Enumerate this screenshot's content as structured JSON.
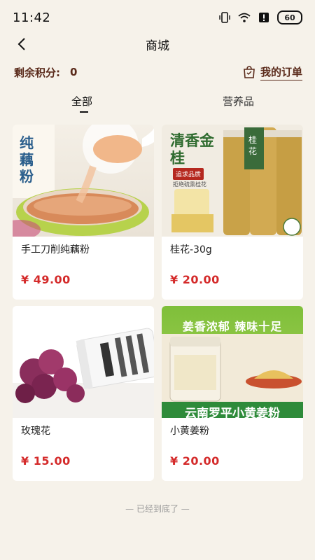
{
  "status_bar": {
    "time": "11:42",
    "battery": "60"
  },
  "nav": {
    "title": "商城"
  },
  "points": {
    "label": "剩余积分:",
    "value": "0"
  },
  "orders": {
    "label": "我的订单"
  },
  "tabs": [
    {
      "label": "全部"
    },
    {
      "label": "营养品"
    }
  ],
  "products": [
    {
      "name": "手工刀削纯藕粉",
      "price": "¥ 49.00",
      "image_text": "纯藕粉"
    },
    {
      "name": "桂花-30g",
      "price": "¥ 20.00",
      "image_title": "清香金桂",
      "image_badge": "追求品质",
      "image_sub": "拒绝硫熏桂花",
      "jar_label": "桂花"
    },
    {
      "name": "玫瑰花",
      "price": "¥ 15.00"
    },
    {
      "name": "小黄姜粉",
      "price": "¥ 20.00",
      "image_top": "姜香浓郁 辣味十足",
      "image_bottom": "云南罗平小黄姜粉"
    }
  ],
  "footer": {
    "end_text": "— 已经到底了 —"
  },
  "colors": {
    "accent_brown": "#5a2a1a",
    "price_red": "#d42a2a",
    "background": "#f6f2ea"
  }
}
